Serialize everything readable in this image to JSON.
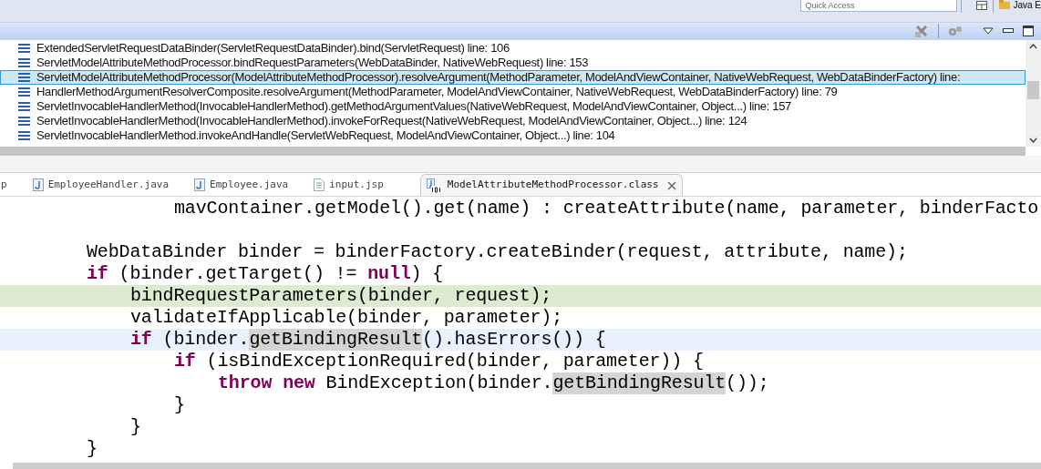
{
  "toolbar": {
    "quick_access": {
      "placeholder": "Quick Access"
    },
    "perspective": "Java E"
  },
  "stack_frames": [
    {
      "text": "ExtendedServletRequestDataBinder(ServletRequestDataBinder).bind(ServletRequest) line: 106",
      "selected": false
    },
    {
      "text": "ServletModelAttributeMethodProcessor.bindRequestParameters(WebDataBinder, NativeWebRequest) line: 153",
      "selected": false
    },
    {
      "text": "ServletModelAttributeMethodProcessor(ModelAttributeMethodProcessor).resolveArgument(MethodParameter, ModelAndViewContainer, NativeWebRequest, WebDataBinderFactory) line:",
      "selected": true
    },
    {
      "text": "HandlerMethodArgumentResolverComposite.resolveArgument(MethodParameter, ModelAndViewContainer, NativeWebRequest, WebDataBinderFactory) line: 79",
      "selected": false
    },
    {
      "text": "ServletInvocableHandlerMethod(InvocableHandlerMethod).getMethodArgumentValues(NativeWebRequest, ModelAndViewContainer, Object...) line: 157",
      "selected": false
    },
    {
      "text": "ServletInvocableHandlerMethod(InvocableHandlerMethod).invokeForRequest(NativeWebRequest, ModelAndViewContainer, Object...) line: 124",
      "selected": false
    },
    {
      "text": "ServletInvocableHandlerMethod.invokeAndHandle(ServletWebRequest, ModelAndViewContainer, Object...) line: 104",
      "selected": false
    }
  ],
  "editor_tabs": [
    {
      "label": "p",
      "kind": "cut",
      "selected": false
    },
    {
      "label": "EmployeeHandler.java",
      "kind": "java",
      "selected": false
    },
    {
      "label": "Employee.java",
      "kind": "java",
      "selected": false
    },
    {
      "label": "input.jsp",
      "kind": "jsp",
      "selected": false
    },
    {
      "label": "ModelAttributeMethodProcessor.class",
      "kind": "class",
      "selected": true
    }
  ],
  "code_lines": [
    {
      "continuation": true,
      "debug_line": false,
      "current_line": false,
      "segments": [
        {
          "text": "mavContainer.getModel().get(name) : createAttribute(name, parameter, binderFacto",
          "kind": "plain"
        }
      ]
    },
    {
      "debug_line": false,
      "current_line": false
    },
    {
      "continuation": false,
      "debug_line": false,
      "current_line": false,
      "segments": [
        {
          "text": "WebDataBinder binder = binderFactory.createBinder(request, attribute, name);",
          "kind": "plain"
        }
      ]
    },
    {
      "continuation": false,
      "debug_line": false,
      "current_line": false,
      "segments": [
        {
          "text": "if",
          "kind": "keyword"
        },
        {
          "text": " (binder.getTarget() != ",
          "kind": "plain"
        },
        {
          "text": "null",
          "kind": "keyword"
        },
        {
          "text": ") {",
          "kind": "plain"
        }
      ],
      "children": [
        {
          "continuation": false,
          "debug_line": true,
          "current_line": false,
          "segments": [
            {
              "text": "bindRequestParameters(binder, request);",
              "kind": "plain"
            }
          ]
        },
        {
          "continuation": false,
          "debug_line": false,
          "current_line": false,
          "segments": [
            {
              "text": "validateIfApplicable(binder, parameter);",
              "kind": "plain"
            }
          ]
        },
        {
          "continuation": false,
          "debug_line": false,
          "current_line": true,
          "segments": [
            {
              "text": "if",
              "kind": "keyword"
            },
            {
              "text": " (binder.",
              "kind": "plain"
            },
            {
              "text": "getBindingResult",
              "kind": "occurrence"
            },
            {
              "text": "().hasErrors()) {",
              "kind": "plain"
            }
          ],
          "children": [
            {
              "continuation": false,
              "debug_line": false,
              "current_line": false,
              "segments": [
                {
                  "text": "if",
                  "kind": "keyword"
                },
                {
                  "text": " (isBindExceptionRequired(binder, parameter)) {",
                  "kind": "plain"
                }
              ],
              "children": [
                {
                  "continuation": false,
                  "debug_line": false,
                  "current_line": false,
                  "segments": [
                    {
                      "text": "throw",
                      "kind": "keyword"
                    },
                    {
                      "text": "new",
                      "kind": "keyword"
                    },
                    {
                      "text": " BindException(binder.",
                      "kind": "plain"
                    },
                    {
                      "text": "getBindingResult",
                      "kind": "occurrence"
                    },
                    {
                      "text": "());",
                      "kind": "plain"
                    }
                  ]
                }
              ]
            },
            {
              "continuation": false,
              "debug_line": false,
              "current_line": false,
              "segments": [
                {
                  "text": "}",
                  "kind": "plain"
                }
              ]
            }
          ]
        },
        {
          "continuation": false,
          "debug_line": false,
          "current_line": false,
          "segments": [
            {
              "text": "}",
              "kind": "plain"
            }
          ]
        }
      ]
    },
    {
      "continuation": false,
      "debug_line": false,
      "current_line": false,
      "segments": [
        {
          "text": "}",
          "kind": "plain"
        }
      ]
    }
  ]
}
